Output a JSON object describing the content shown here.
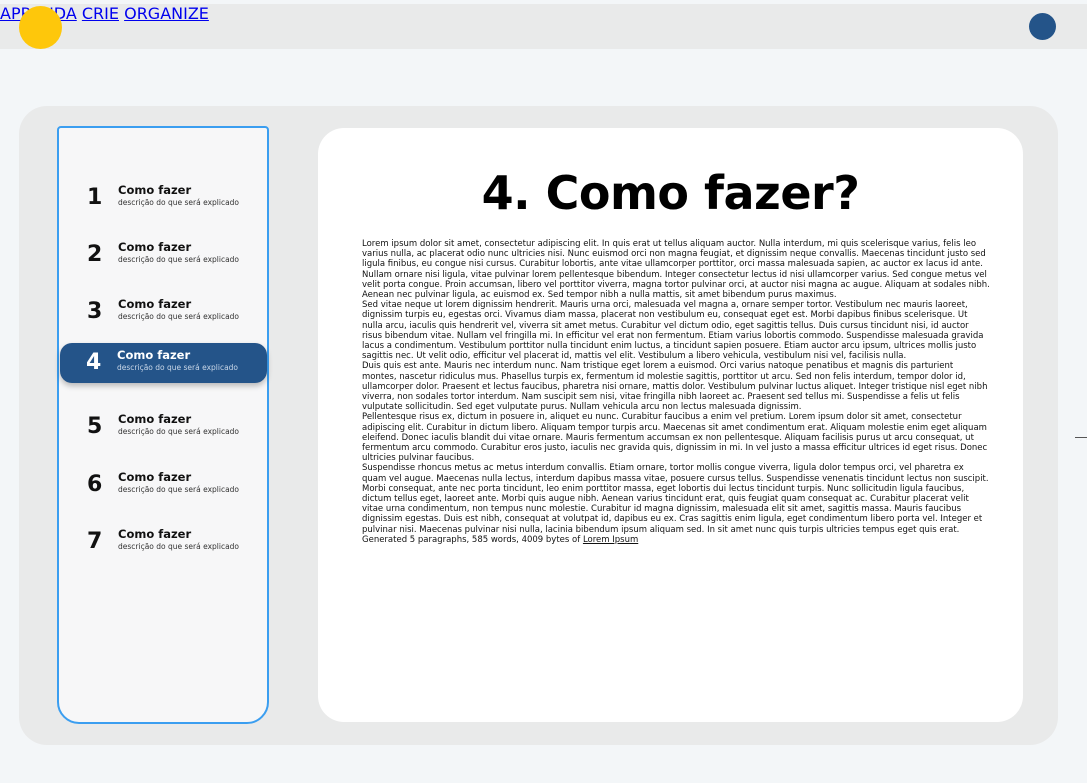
{
  "nav": {
    "items": [
      "APRENDA",
      "CRIE",
      "ORGANIZE"
    ]
  },
  "colors": {
    "brand_yellow": "#fec70b",
    "brand_blue": "#245489",
    "selection_outline": "#3b9ef0"
  },
  "sidebar": {
    "steps": [
      {
        "number": "1",
        "title": "Como fazer",
        "description": "descrição do que será explicado"
      },
      {
        "number": "2",
        "title": "Como fazer",
        "description": "descrição do que será explicado"
      },
      {
        "number": "3",
        "title": "Como fazer",
        "description": "descrição do que será explicado"
      },
      {
        "number": "4",
        "title": "Como fazer",
        "description": "descrição do que será explicado"
      },
      {
        "number": "5",
        "title": "Como fazer",
        "description": "descrição do que será explicado"
      },
      {
        "number": "6",
        "title": "Como fazer",
        "description": "descrição do que será explicado"
      },
      {
        "number": "7",
        "title": "Como fazer",
        "description": "descrição do que será explicado"
      }
    ]
  },
  "main": {
    "heading": "4. Como fazer?",
    "paragraphs": [
      "Lorem ipsum dolor sit amet, consectetur adipiscing elit. In quis erat ut tellus aliquam auctor. Nulla interdum, mi quis scelerisque varius, felis leo varius nulla, ac placerat odio nunc ultricies nisi. Nunc euismod orci non magna feugiat, et dignissim neque convallis. Maecenas tincidunt justo sed ligula finibus, eu congue nisi cursus. Curabitur lobortis, ante vitae ullamcorper porttitor, orci massa malesuada sapien, ac auctor ex lacus id ante. Nullam ornare nisi ligula, vitae pulvinar lorem pellentesque bibendum. Integer consectetur lectus id nisi ullamcorper varius. Sed congue metus vel velit porta congue. Proin accumsan, libero vel porttitor viverra, magna tortor pulvinar orci, at auctor nisi magna ac augue. Aliquam at sodales nibh. Aenean nec pulvinar ligula, ac euismod ex. Sed tempor nibh a nulla mattis, sit amet bibendum purus maximus.",
      "Sed vitae neque ut lorem dignissim hendrerit. Mauris urna orci, malesuada vel magna a, ornare semper tortor. Vestibulum nec mauris laoreet, dignissim turpis eu, egestas orci. Vivamus diam massa, placerat non vestibulum eu, consequat eget est. Morbi dapibus finibus scelerisque. Ut nulla arcu, iaculis quis hendrerit vel, viverra sit amet metus. Curabitur vel dictum odio, eget sagittis tellus. Duis cursus tincidunt nisi, id auctor risus bibendum vitae. Nullam vel fringilla mi. In efficitur vel erat non fermentum. Etiam varius lobortis commodo. Suspendisse malesuada gravida lacus a condimentum. Vestibulum porttitor nulla tincidunt enim luctus, a tincidunt sapien posuere. Etiam auctor arcu ipsum, ultrices mollis justo sagittis nec. Ut velit odio, efficitur vel placerat id, mattis vel elit. Vestibulum a libero vehicula, vestibulum nisi vel, facilisis nulla.",
      "Duis quis est ante. Mauris nec interdum nunc. Nam tristique eget lorem a euismod. Orci varius natoque penatibus et magnis dis parturient montes, nascetur ridiculus mus. Phasellus turpis ex, fermentum id molestie sagittis, porttitor ut arcu. Sed non felis interdum, tempor dolor id, ullamcorper dolor. Praesent et lectus faucibus, pharetra nisi ornare, mattis dolor. Vestibulum pulvinar luctus aliquet. Integer tristique nisl eget nibh viverra, non sodales tortor interdum. Nam suscipit sem nisi, vitae fringilla nibh laoreet ac. Praesent sed tellus mi. Suspendisse a felis ut felis vulputate sollicitudin. Sed eget vulputate purus. Nullam vehicula arcu non lectus malesuada dignissim.",
      "Pellentesque risus ex, dictum in posuere in, aliquet eu nunc. Curabitur faucibus a enim vel pretium. Lorem ipsum dolor sit amet, consectetur adipiscing elit. Curabitur in dictum libero. Aliquam tempor turpis arcu. Maecenas sit amet condimentum erat. Aliquam molestie enim eget aliquam eleifend. Donec iaculis blandit dui vitae ornare. Mauris fermentum accumsan ex non pellentesque. Aliquam facilisis purus ut arcu consequat, ut fermentum arcu commodo. Curabitur eros justo, iaculis nec gravida quis, dignissim in mi. In vel justo a massa efficitur ultrices id eget risus. Donec ultricies pulvinar faucibus.",
      "Suspendisse rhoncus metus ac metus interdum convallis. Etiam ornare, tortor mollis congue viverra, ligula dolor tempus orci, vel pharetra ex quam vel augue. Maecenas nulla lectus, interdum dapibus massa vitae, posuere cursus tellus. Suspendisse venenatis tincidunt lectus non suscipit. Morbi consequat, ante nec porta tincidunt, leo enim porttitor massa, eget lobortis dui lectus tincidunt turpis. Nunc sollicitudin ligula faucibus, dictum tellus eget, laoreet ante. Morbi quis augue nibh. Aenean varius tincidunt erat, quis feugiat quam consequat ac. Curabitur placerat velit vitae urna condimentum, non tempus nunc molestie. Curabitur id magna dignissim, malesuada elit sit amet, sagittis massa. Mauris faucibus dignissim egestas. Duis est nibh, consequat at volutpat id, dapibus eu ex. Cras sagittis enim ligula, eget condimentum libero porta vel. Integer et pulvinar nisi. Maecenas pulvinar nisi nulla, lacinia bibendum ipsum aliquam sed. In sit amet nunc quis turpis ultricies tempus eget quis erat."
    ],
    "generated_prefix": "Generated 5 paragraphs, 585 words, 4009 bytes of ",
    "generated_link": "Lorem Ipsum"
  }
}
